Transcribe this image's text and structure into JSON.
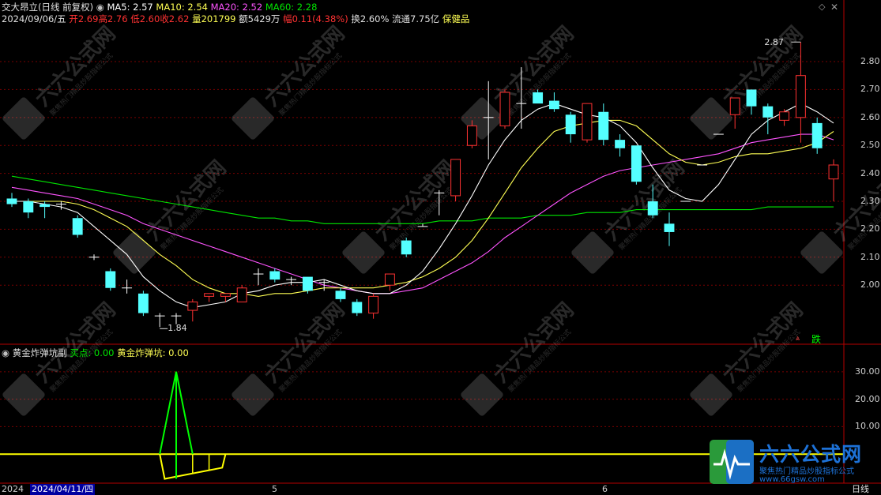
{
  "header": {
    "stock_name": "交大昂立",
    "mode": "(日线 前复权)",
    "ma5": "MA5: 2.57",
    "ma10": "MA10: 2.54",
    "ma20": "MA20: 2.52",
    "ma60": "MA60: 2.28",
    "date": "2024/09/06/五",
    "open": "开2.69",
    "high": "高2.76",
    "low": "低2.60",
    "close": "收2.62",
    "volume": "量201799",
    "amount": "额5429万",
    "change": "幅0.11(4.38%)",
    "turnover": "换2.60%",
    "float_value": "流通7.75亿",
    "sector": "保健品"
  },
  "indicator": {
    "name": "黄金炸弹坑副",
    "buy_point": "买点: 0.00",
    "golden_pit": "黄金炸弹坑: 0.00"
  },
  "annotations": {
    "high_mark": "2.87",
    "low_mark": "1.84",
    "signal": "跌"
  },
  "bottom": {
    "date_left": "2024",
    "date_cursor": "2024/04/11/四",
    "month_5": "5",
    "month_6": "6",
    "period": "日线"
  },
  "watermark": {
    "brand": "六六公式网",
    "slogan": "聚焦热门精品炒股指标公式",
    "url": "www.66gsw.com"
  },
  "colors": {
    "up": "#ff3232",
    "down": "#54ffff",
    "ma5": "#ffffff",
    "ma10": "#ffff54",
    "ma20": "#ff54ff",
    "ma60": "#00e600",
    "indicator": "#ffff00",
    "spike": "#00ff00",
    "border": "#b40000"
  },
  "price_axis": [
    "2.80",
    "2.70",
    "2.60",
    "2.50",
    "2.40",
    "2.30",
    "2.20",
    "2.10",
    "2.00"
  ],
  "indicator_axis": [
    "30.00",
    "20.00",
    "10.00"
  ],
  "chart_data": {
    "type": "candlestick",
    "candles": [
      {
        "o": 2.31,
        "h": 2.33,
        "l": 2.28,
        "c": 2.29
      },
      {
        "o": 2.3,
        "h": 2.31,
        "l": 2.24,
        "c": 2.26
      },
      {
        "o": 2.29,
        "h": 2.3,
        "l": 2.24,
        "c": 2.28
      },
      {
        "o": 2.29,
        "h": 2.3,
        "l": 2.27,
        "c": 2.29
      },
      {
        "o": 2.24,
        "h": 2.25,
        "l": 2.17,
        "c": 2.18
      },
      {
        "o": 2.1,
        "h": 2.11,
        "l": 2.09,
        "c": 2.1
      },
      {
        "o": 2.05,
        "h": 2.06,
        "l": 1.98,
        "c": 1.99
      },
      {
        "o": 1.99,
        "h": 2.02,
        "l": 1.97,
        "c": 1.99
      },
      {
        "o": 1.97,
        "h": 1.98,
        "l": 1.89,
        "c": 1.9
      },
      {
        "o": 1.89,
        "h": 1.9,
        "l": 1.85,
        "c": 1.89
      },
      {
        "o": 1.89,
        "h": 1.9,
        "l": 1.86,
        "c": 1.89
      },
      {
        "o": 1.91,
        "h": 1.95,
        "l": 1.87,
        "c": 1.94
      },
      {
        "o": 1.96,
        "h": 1.97,
        "l": 1.94,
        "c": 1.97
      },
      {
        "o": 1.96,
        "h": 1.97,
        "l": 1.94,
        "c": 1.97
      },
      {
        "o": 1.94,
        "h": 2.0,
        "l": 1.94,
        "c": 1.99
      },
      {
        "o": 2.04,
        "h": 2.06,
        "l": 2.0,
        "c": 2.04
      },
      {
        "o": 2.05,
        "h": 2.06,
        "l": 2.01,
        "c": 2.02
      },
      {
        "o": 2.02,
        "h": 2.03,
        "l": 2.0,
        "c": 2.02
      },
      {
        "o": 2.03,
        "h": 2.03,
        "l": 1.97,
        "c": 1.98
      },
      {
        "o": 2.01,
        "h": 2.02,
        "l": 1.98,
        "c": 2.01
      },
      {
        "o": 1.98,
        "h": 1.99,
        "l": 1.94,
        "c": 1.95
      },
      {
        "o": 1.94,
        "h": 1.95,
        "l": 1.89,
        "c": 1.9
      },
      {
        "o": 1.9,
        "h": 1.97,
        "l": 1.88,
        "c": 1.96
      },
      {
        "o": 2.0,
        "h": 2.04,
        "l": 1.98,
        "c": 2.04
      },
      {
        "o": 2.16,
        "h": 2.17,
        "l": 2.1,
        "c": 2.11
      },
      {
        "o": 2.21,
        "h": 2.22,
        "l": 2.21,
        "c": 2.21
      },
      {
        "o": 2.33,
        "h": 2.34,
        "l": 2.25,
        "c": 2.33
      },
      {
        "o": 2.32,
        "h": 2.45,
        "l": 2.3,
        "c": 2.45
      },
      {
        "o": 2.5,
        "h": 2.59,
        "l": 2.49,
        "c": 2.57
      },
      {
        "o": 2.6,
        "h": 2.73,
        "l": 2.45,
        "c": 2.6
      },
      {
        "o": 2.57,
        "h": 2.7,
        "l": 2.56,
        "c": 2.69
      },
      {
        "o": 2.65,
        "h": 2.78,
        "l": 2.56,
        "c": 2.65
      },
      {
        "o": 2.69,
        "h": 2.7,
        "l": 2.65,
        "c": 2.65
      },
      {
        "o": 2.66,
        "h": 2.69,
        "l": 2.62,
        "c": 2.63
      },
      {
        "o": 2.61,
        "h": 2.62,
        "l": 2.51,
        "c": 2.54
      },
      {
        "o": 2.52,
        "h": 2.65,
        "l": 2.51,
        "c": 2.65
      },
      {
        "o": 2.62,
        "h": 2.65,
        "l": 2.5,
        "c": 2.52
      },
      {
        "o": 2.52,
        "h": 2.54,
        "l": 2.46,
        "c": 2.49
      },
      {
        "o": 2.5,
        "h": 2.5,
        "l": 2.36,
        "c": 2.37
      },
      {
        "o": 2.3,
        "h": 2.36,
        "l": 2.24,
        "c": 2.25
      },
      {
        "o": 2.22,
        "h": 2.26,
        "l": 2.14,
        "c": 2.19
      },
      {
        "o": 2.3,
        "h": 2.3,
        "l": 2.3,
        "c": 2.3
      },
      {
        "o": 2.43,
        "h": 2.43,
        "l": 2.43,
        "c": 2.43
      },
      {
        "o": 2.54,
        "h": 2.54,
        "l": 2.54,
        "c": 2.54
      },
      {
        "o": 2.61,
        "h": 2.67,
        "l": 2.56,
        "c": 2.67
      },
      {
        "o": 2.7,
        "h": 2.7,
        "l": 2.61,
        "c": 2.64
      },
      {
        "o": 2.64,
        "h": 2.65,
        "l": 2.54,
        "c": 2.6
      },
      {
        "o": 2.59,
        "h": 2.63,
        "l": 2.57,
        "c": 2.62
      },
      {
        "o": 2.6,
        "h": 2.87,
        "l": 2.51,
        "c": 2.75
      },
      {
        "o": 2.58,
        "h": 2.6,
        "l": 2.47,
        "c": 2.49
      },
      {
        "o": 2.38,
        "h": 2.45,
        "l": 2.3,
        "c": 2.43
      }
    ],
    "ma5": [
      2.3,
      2.3,
      2.29,
      2.28,
      2.26,
      2.21,
      2.16,
      2.11,
      2.03,
      1.98,
      1.94,
      1.92,
      1.93,
      1.94,
      1.97,
      1.98,
      2.0,
      2.01,
      2.01,
      2.02,
      2.0,
      1.98,
      1.97,
      1.97,
      2.0,
      2.05,
      2.13,
      2.22,
      2.32,
      2.43,
      2.52,
      2.59,
      2.63,
      2.65,
      2.63,
      2.61,
      2.6,
      2.57,
      2.51,
      2.42,
      2.34,
      2.31,
      2.3,
      2.36,
      2.45,
      2.54,
      2.59,
      2.62,
      2.65,
      2.62,
      2.58
    ],
    "ma10": [
      2.3,
      2.3,
      2.3,
      2.3,
      2.29,
      2.27,
      2.24,
      2.21,
      2.16,
      2.11,
      2.07,
      2.02,
      1.99,
      1.97,
      1.97,
      1.96,
      1.97,
      1.97,
      1.98,
      1.99,
      1.99,
      1.99,
      1.99,
      2.0,
      2.01,
      2.03,
      2.06,
      2.1,
      2.16,
      2.24,
      2.33,
      2.42,
      2.49,
      2.55,
      2.57,
      2.58,
      2.59,
      2.59,
      2.57,
      2.52,
      2.47,
      2.44,
      2.43,
      2.44,
      2.46,
      2.47,
      2.47,
      2.48,
      2.49,
      2.51,
      2.55
    ],
    "ma20": [
      2.35,
      2.34,
      2.33,
      2.32,
      2.31,
      2.29,
      2.27,
      2.25,
      2.22,
      2.2,
      2.18,
      2.16,
      2.14,
      2.12,
      2.1,
      2.08,
      2.06,
      2.04,
      2.02,
      2.0,
      1.99,
      1.98,
      1.97,
      1.97,
      1.98,
      1.99,
      2.02,
      2.05,
      2.08,
      2.12,
      2.17,
      2.21,
      2.25,
      2.29,
      2.33,
      2.36,
      2.39,
      2.41,
      2.42,
      2.43,
      2.44,
      2.45,
      2.46,
      2.47,
      2.49,
      2.51,
      2.52,
      2.53,
      2.54,
      2.54,
      2.52
    ],
    "ma60": [
      2.39,
      2.38,
      2.37,
      2.36,
      2.35,
      2.34,
      2.33,
      2.32,
      2.31,
      2.3,
      2.29,
      2.28,
      2.27,
      2.26,
      2.25,
      2.24,
      2.24,
      2.23,
      2.23,
      2.22,
      2.22,
      2.22,
      2.22,
      2.22,
      2.22,
      2.22,
      2.23,
      2.23,
      2.23,
      2.24,
      2.24,
      2.24,
      2.25,
      2.25,
      2.25,
      2.26,
      2.26,
      2.26,
      2.27,
      2.27,
      2.27,
      2.27,
      2.27,
      2.27,
      2.27,
      2.27,
      2.28,
      2.28,
      2.28,
      2.28,
      2.28
    ],
    "ylim": [
      1.8,
      2.93
    ],
    "indicator_series": {
      "baseline": 0,
      "spike": {
        "peak": 30,
        "center_index": 10
      },
      "dip": {
        "min": -9,
        "range": [
          9,
          13
        ]
      }
    },
    "indicator_ylim": [
      -10,
      36
    ]
  }
}
